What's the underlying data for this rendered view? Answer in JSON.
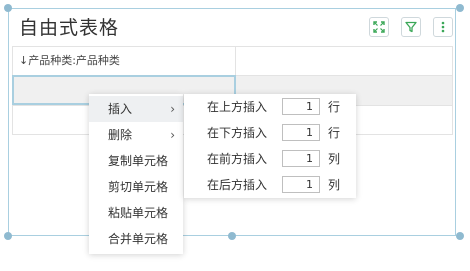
{
  "widget": {
    "title": "自由式表格",
    "toolbar": [
      {
        "icon": "expand-icon"
      },
      {
        "icon": "filter-icon"
      },
      {
        "icon": "more-vertical-icon"
      }
    ],
    "accent_color": "#3aa757"
  },
  "grid": {
    "header_cell": "↓产品种类:产品种类"
  },
  "context_menu": {
    "items": [
      {
        "label": "插入",
        "has_submenu": true,
        "chevron": "›"
      },
      {
        "label": "删除",
        "has_submenu": true,
        "chevron": "›"
      },
      {
        "label": "复制单元格"
      },
      {
        "label": "剪切单元格"
      },
      {
        "label": "粘贴单元格"
      },
      {
        "label": "合并单元格"
      }
    ]
  },
  "insert_submenu": {
    "rows": [
      {
        "label": "在上方插入",
        "value": "1",
        "unit": "行"
      },
      {
        "label": "在下方插入",
        "value": "1",
        "unit": "行"
      },
      {
        "label": "在前方插入",
        "value": "1",
        "unit": "列"
      },
      {
        "label": "在后方插入",
        "value": "1",
        "unit": "列"
      }
    ]
  }
}
